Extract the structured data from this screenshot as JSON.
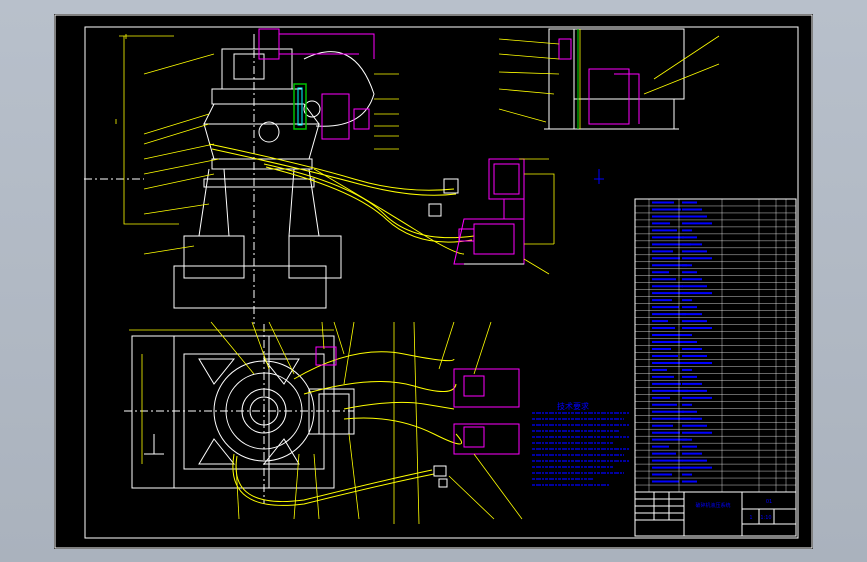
{
  "colors": {
    "frame": "#ffffff",
    "leader": "#ffff00",
    "equipment": "#ffffff",
    "highlight": "#ff00ff",
    "notes": "#0000ff",
    "table": "#0000ff",
    "accent_green": "#00c000",
    "accent_cyan": "#00ffff"
  },
  "notes": {
    "heading": "技术要求"
  },
  "title_block": {
    "drawing_title": "破碎机液压系统",
    "drawing_no": "01",
    "sheet": "1",
    "scale": "1:10"
  }
}
